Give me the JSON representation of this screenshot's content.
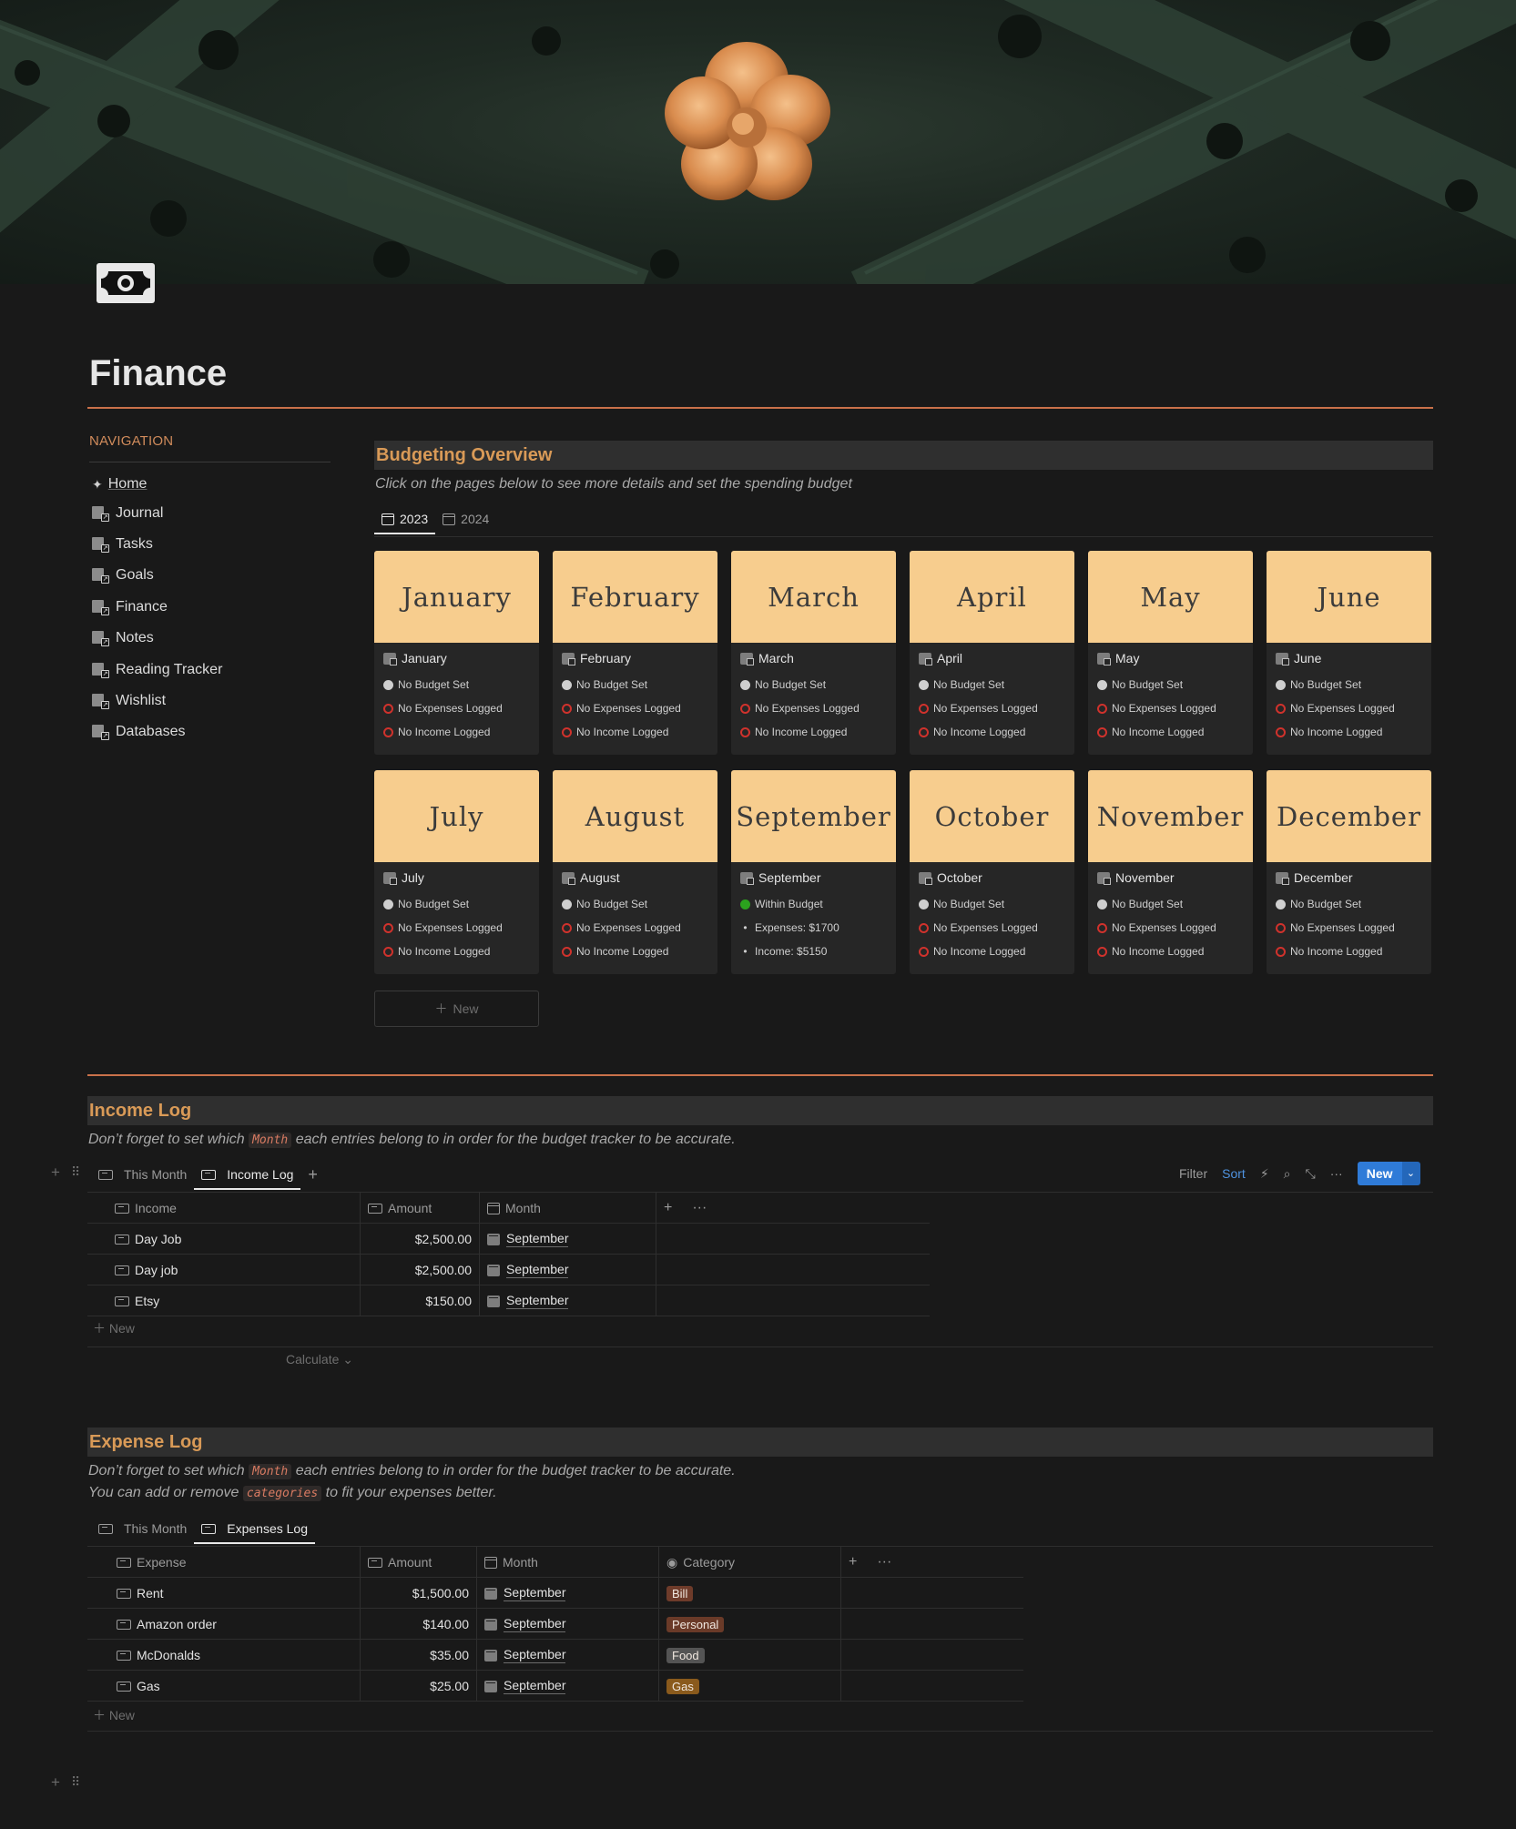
{
  "page": {
    "title": "Finance",
    "accent": "#c9714a"
  },
  "navigation": {
    "heading": "NAVIGATION",
    "items": [
      {
        "label": "Home",
        "icon": "sparkle-icon"
      },
      {
        "label": "Journal",
        "icon": "journal-link-icon"
      },
      {
        "label": "Tasks",
        "icon": "tasks-link-icon"
      },
      {
        "label": "Goals",
        "icon": "goals-link-icon"
      },
      {
        "label": "Finance",
        "icon": "finance-link-icon"
      },
      {
        "label": "Notes",
        "icon": "notes-link-icon"
      },
      {
        "label": "Reading Tracker",
        "icon": "reading-link-icon"
      },
      {
        "label": "Wishlist",
        "icon": "wishlist-link-icon"
      },
      {
        "label": "Databases",
        "icon": "databases-link-icon"
      }
    ]
  },
  "budgeting": {
    "heading": "Budgeting Overview",
    "subtitle": "Click on the pages below to see more details and set the spending budget",
    "tabs": [
      "2023",
      "2024"
    ],
    "new_label": "New",
    "months": [
      {
        "cover": "January",
        "name": "January",
        "status": "No Budget Set",
        "expenses": "No Expenses Logged",
        "income": "No Income Logged"
      },
      {
        "cover": "February",
        "name": "February",
        "status": "No Budget Set",
        "expenses": "No Expenses Logged",
        "income": "No Income Logged"
      },
      {
        "cover": "March",
        "name": "March",
        "status": "No Budget Set",
        "expenses": "No Expenses Logged",
        "income": "No Income Logged"
      },
      {
        "cover": "April",
        "name": "April",
        "status": "No Budget Set",
        "expenses": "No Expenses Logged",
        "income": "No Income Logged"
      },
      {
        "cover": "May",
        "name": "May",
        "status": "No Budget Set",
        "expenses": "No Expenses Logged",
        "income": "No Income Logged"
      },
      {
        "cover": "June",
        "name": "June",
        "status": "No Budget Set",
        "expenses": "No Expenses Logged",
        "income": "No Income Logged"
      },
      {
        "cover": "July",
        "name": "July",
        "status": "No Budget Set",
        "expenses": "No Expenses Logged",
        "income": "No Income Logged"
      },
      {
        "cover": "August",
        "name": "August",
        "status": "No Budget Set",
        "expenses": "No Expenses Logged",
        "income": "No Income Logged"
      },
      {
        "cover": "September",
        "name": "September",
        "status": "Within Budget",
        "expenses": "Expenses: $1700",
        "income": "Income: $5150"
      },
      {
        "cover": "October",
        "name": "October",
        "status": "No Budget Set",
        "expenses": "No Expenses Logged",
        "income": "No Income Logged"
      },
      {
        "cover": "November",
        "name": "November",
        "status": "No Budget Set",
        "expenses": "No Expenses Logged",
        "income": "No Income Logged"
      },
      {
        "cover": "December",
        "name": "December",
        "status": "No Budget Set",
        "expenses": "No Expenses Logged",
        "income": "No Income Logged"
      }
    ]
  },
  "income_log": {
    "heading": "Income Log",
    "note_before": "Don’t forget to set which",
    "note_code": "Month",
    "note_after": "each entries belong to in order for the budget tracker to be accurate.",
    "tabs": [
      "This Month",
      "Income Log"
    ],
    "toolbar": {
      "filter": "Filter",
      "sort": "Sort",
      "new": "New"
    },
    "columns": [
      "Income",
      "Amount",
      "Month"
    ],
    "rows": [
      {
        "name": "Day Job",
        "amount": "$2,500.00",
        "month": "September"
      },
      {
        "name": "Day job",
        "amount": "$2,500.00",
        "month": "September"
      },
      {
        "name": "Etsy",
        "amount": "$150.00",
        "month": "September"
      }
    ],
    "new_row": "New",
    "calculate": "Calculate"
  },
  "expense_log": {
    "heading": "Expense Log",
    "note_before": "Don’t forget to set which",
    "note_code": "Month",
    "note_after": "each entries belong to in order for the budget tracker to be accurate.",
    "note2_before": "You can add or remove",
    "note2_code": "categories",
    "note2_after": "to fit your expenses better.",
    "tabs": [
      "This Month",
      "Expenses Log"
    ],
    "columns": [
      "Expense",
      "Amount",
      "Month",
      "Category"
    ],
    "rows": [
      {
        "name": "Rent",
        "amount": "$1,500.00",
        "month": "September",
        "category": "Bill",
        "color": "#6e3b2a"
      },
      {
        "name": "Amazon order",
        "amount": "$140.00",
        "month": "September",
        "category": "Personal",
        "color": "#6a3a28"
      },
      {
        "name": "McDonalds",
        "amount": "$35.00",
        "month": "September",
        "category": "Food",
        "color": "#545454"
      },
      {
        "name": "Gas",
        "amount": "$25.00",
        "month": "September",
        "category": "Gas",
        "color": "#8a5a1c"
      }
    ],
    "new_row": "New"
  }
}
